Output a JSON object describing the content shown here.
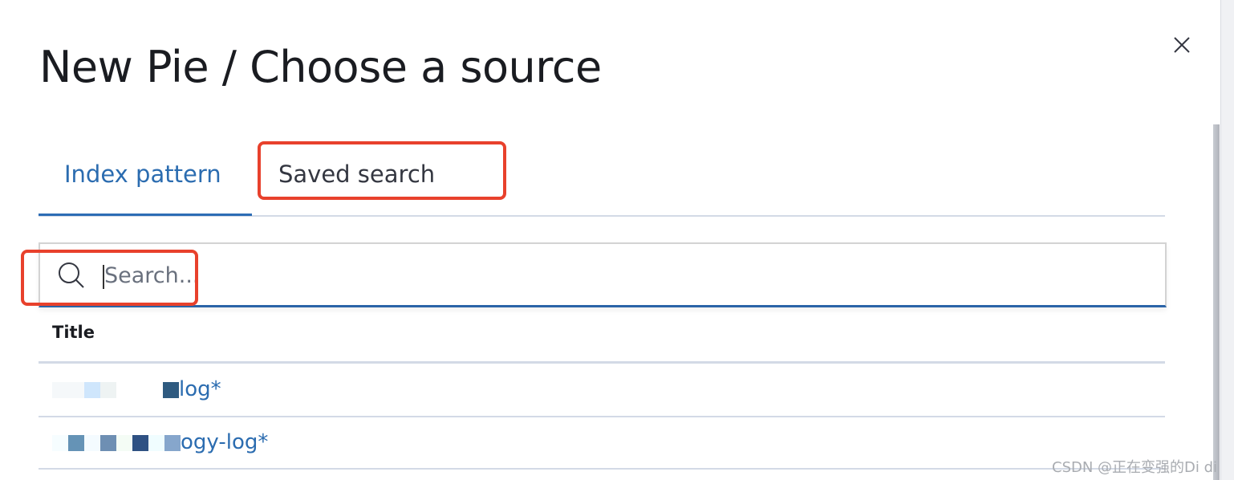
{
  "modal": {
    "title": "New Pie / Choose a source",
    "close_icon": "close-icon",
    "tabs": [
      {
        "label": "Index pattern",
        "selected": true
      },
      {
        "label": "Saved search",
        "selected": false
      }
    ],
    "search": {
      "placeholder": "Search...",
      "value": "",
      "icon": "search-icon"
    },
    "table": {
      "column_header": "Title",
      "rows": [
        {
          "visible_text": "log*"
        },
        {
          "visible_text": "ogy-log*"
        }
      ]
    }
  },
  "watermark": "CSDN @正在变强的Di di",
  "colors": {
    "accent": "#2b6cb0",
    "annotation": "#e8412c",
    "text": "#1a1c21"
  }
}
